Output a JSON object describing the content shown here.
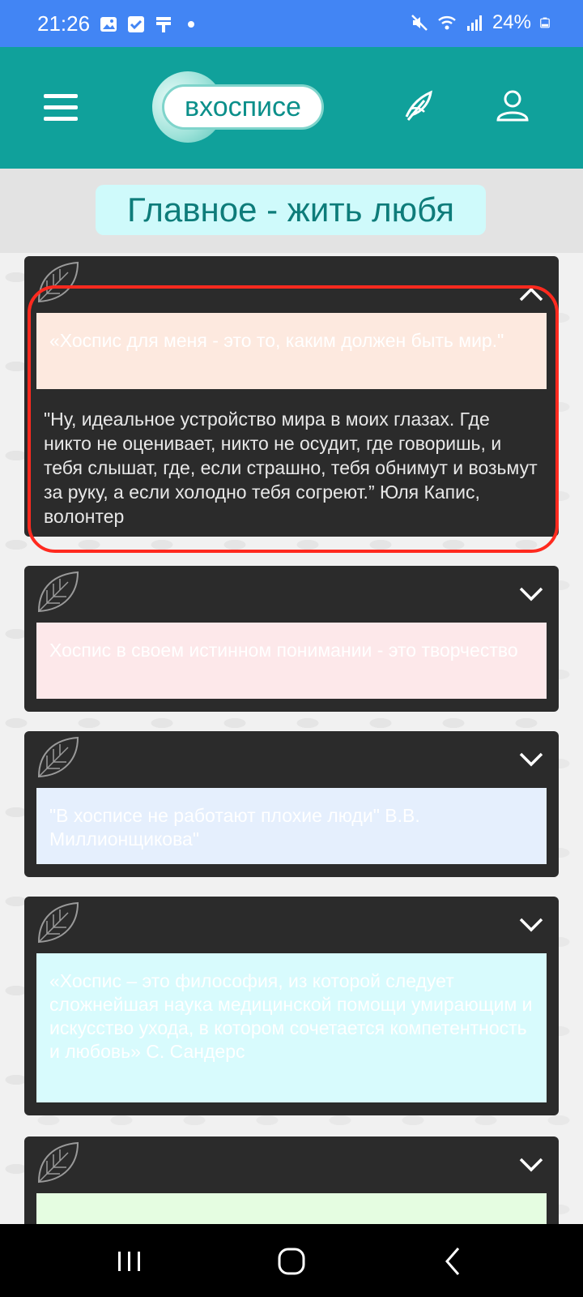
{
  "status_bar": {
    "time": "21:26",
    "battery": "24%",
    "icons": [
      "photo-icon",
      "check-icon",
      "notification-icon",
      "dot-icon",
      "mute-icon",
      "wifi-icon",
      "signal-icon",
      "battery-icon"
    ]
  },
  "header": {
    "logo_text": "вхосписе",
    "menu_icon": "hamburger-icon",
    "feather_icon": "feather-icon",
    "profile_icon": "user-icon",
    "bg_color": "#10a19b"
  },
  "banner": {
    "title": "Главное - жить любя"
  },
  "cards": [
    {
      "quote": "«Хоспис для меня - это то, каким должен быть мир.\"",
      "quote_bg": "#fde9df",
      "expanded": true,
      "body": "\"Ну, идеальное устройство мира в моих глазах. Где никто не оценивает, никто не осудит, где говоришь, и тебя слышат, где, если страшно, тебя обнимут и возьмут за руку, а если холодно тебя согреют.” Юля Капис, волонтер"
    },
    {
      "quote": "Хоспис в своем истинном понимании - это творчество",
      "quote_bg": "#fde8ea",
      "expanded": false
    },
    {
      "quote": "\"В хосписе не работают плохие люди\" В.В. Миллионщикова\"",
      "quote_bg": "#e5effd",
      "expanded": false
    },
    {
      "quote": "«Хоспис – это философия, из которой следует сложнейшая наука медицинской помощи умирающим и искусство ухода, в котором сочетается компетентность и любовь» С. Сандерс",
      "quote_bg": "#d8fbfd",
      "expanded": false
    },
    {
      "quote": "",
      "quote_bg": "#e5fde1",
      "expanded": false
    }
  ],
  "nav_bar": {
    "recents_icon": "recents-icon",
    "home_icon": "home-icon",
    "back_icon": "back-icon"
  }
}
